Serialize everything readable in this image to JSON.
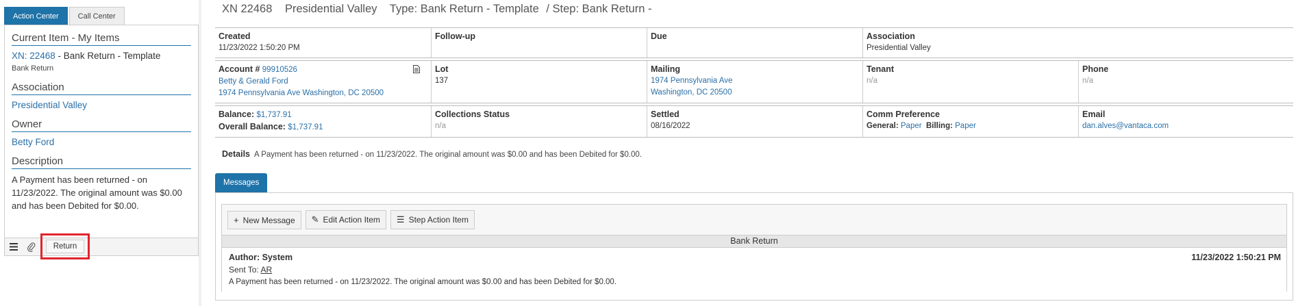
{
  "left": {
    "tabs": [
      "Action Center",
      "Call Center"
    ],
    "current_item": {
      "heading": "Current Item - My Items",
      "xn_link": "XN: 22468",
      "xn_rest": " - Bank Return - Template",
      "sub": "Bank Return"
    },
    "association": {
      "heading": "Association",
      "value": "Presidential Valley"
    },
    "owner": {
      "heading": "Owner",
      "value": "Betty Ford"
    },
    "description": {
      "heading": "Description",
      "text": "A Payment has been returned - on 11/23/2022. The original amount was $0.00 and has been Debited for $0.00."
    },
    "bottom_bar": {
      "menu_icon": "menu-icon",
      "attach_icon": "paperclip-icon",
      "return_label": "Return"
    }
  },
  "header": {
    "xn": "XN 22468",
    "association": "Presidential Valley",
    "type": "Type: Bank Return - Template",
    "step": "/ Step: Bank Return -"
  },
  "row1": {
    "created_label": "Created",
    "created_value": "11/23/2022 1:50:20 PM",
    "followup_label": "Follow-up",
    "due_label": "Due",
    "association_label": "Association",
    "association_value": "Presidential Valley"
  },
  "row2": {
    "account_label": "Account #",
    "account_number": "99910526",
    "owner_name": "Betty & Gerald Ford",
    "owner_address": "1974 Pennsylvania Ave Washington, DC 20500",
    "lot_label": "Lot",
    "lot_value": "137",
    "mailing_label": "Mailing",
    "mailing_line1": "1974 Pennsylvania Ave",
    "mailing_line2": "Washington, DC 20500",
    "tenant_label": "Tenant",
    "tenant_value": "n/a",
    "phone_label": "Phone",
    "phone_value": "n/a"
  },
  "row3": {
    "balance_label": "Balance:",
    "balance_value": "$1,737.91",
    "overall_label": "Overall Balance:",
    "overall_value": "$1,737.91",
    "collections_label": "Collections Status",
    "collections_value": "n/a",
    "settled_label": "Settled",
    "settled_value": "08/16/2022",
    "comm_label": "Comm Preference",
    "general_label": "General:",
    "general_value": "Paper",
    "billing_label": "Billing:",
    "billing_value": "Paper",
    "email_label": "Email",
    "email_value": "dan.alves@vantaca.com"
  },
  "details": {
    "label": "Details",
    "text": "A Payment has been returned - on 11/23/2022. The original amount was $0.00 and has been Debited for $0.00."
  },
  "messages": {
    "tab": "Messages",
    "toolbar": {
      "new": "New Message",
      "edit": "Edit Action Item",
      "step": "Step Action Item"
    },
    "item": {
      "heading": "Bank Return",
      "author": "Author: System",
      "sent_to_label": "Sent To:",
      "sent_to_value": "AR",
      "date": "11/23/2022 1:50:21 PM",
      "body": "A Payment has been returned - on 11/23/2022. The original amount was $0.00 and has been Debited for $0.00."
    }
  }
}
